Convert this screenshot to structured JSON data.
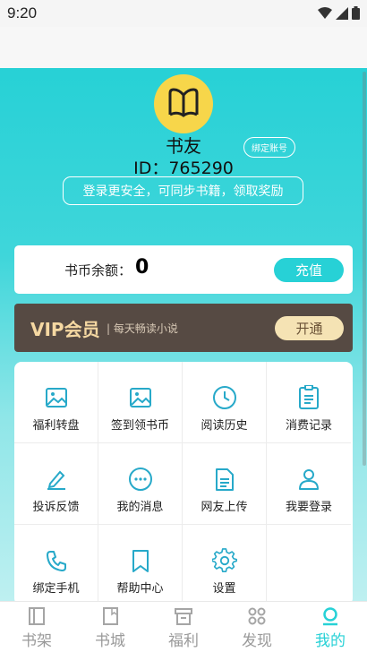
{
  "status_bar": {
    "time": "9:20"
  },
  "profile": {
    "nickname": "书友",
    "bind_account_label": "绑定账号",
    "user_id": "ID：765290",
    "login_hint": "登录更安全，可同步书籍，领取奖励"
  },
  "coins": {
    "label": "书币余额：",
    "value": "0",
    "recharge_label": "充值"
  },
  "vip": {
    "title": "VIP会员",
    "subtitle": "| 每天畅读小说",
    "open_label": "开通"
  },
  "grid": {
    "items": [
      {
        "label": "福利转盘",
        "icon": "image-icon"
      },
      {
        "label": "签到领书币",
        "icon": "image-icon"
      },
      {
        "label": "阅读历史",
        "icon": "clock-icon"
      },
      {
        "label": "消费记录",
        "icon": "receipt-icon"
      },
      {
        "label": "投诉反馈",
        "icon": "pencil-icon"
      },
      {
        "label": "我的消息",
        "icon": "message-icon"
      },
      {
        "label": "网友上传",
        "icon": "document-icon"
      },
      {
        "label": "我要登录",
        "icon": "user-icon"
      },
      {
        "label": "绑定手机",
        "icon": "phone-icon"
      },
      {
        "label": "帮助中心",
        "icon": "bookmark-icon"
      },
      {
        "label": "设置",
        "icon": "gear-icon"
      }
    ]
  },
  "bottom_nav": {
    "items": [
      {
        "label": "书架"
      },
      {
        "label": "书城"
      },
      {
        "label": "福利"
      },
      {
        "label": "发现"
      },
      {
        "label": "我的"
      }
    ]
  },
  "colors": {
    "accent": "#27d1d6",
    "vip_bg": "#564a43",
    "vip_text": "#f5d8a2",
    "avatar": "#f7d64a"
  }
}
